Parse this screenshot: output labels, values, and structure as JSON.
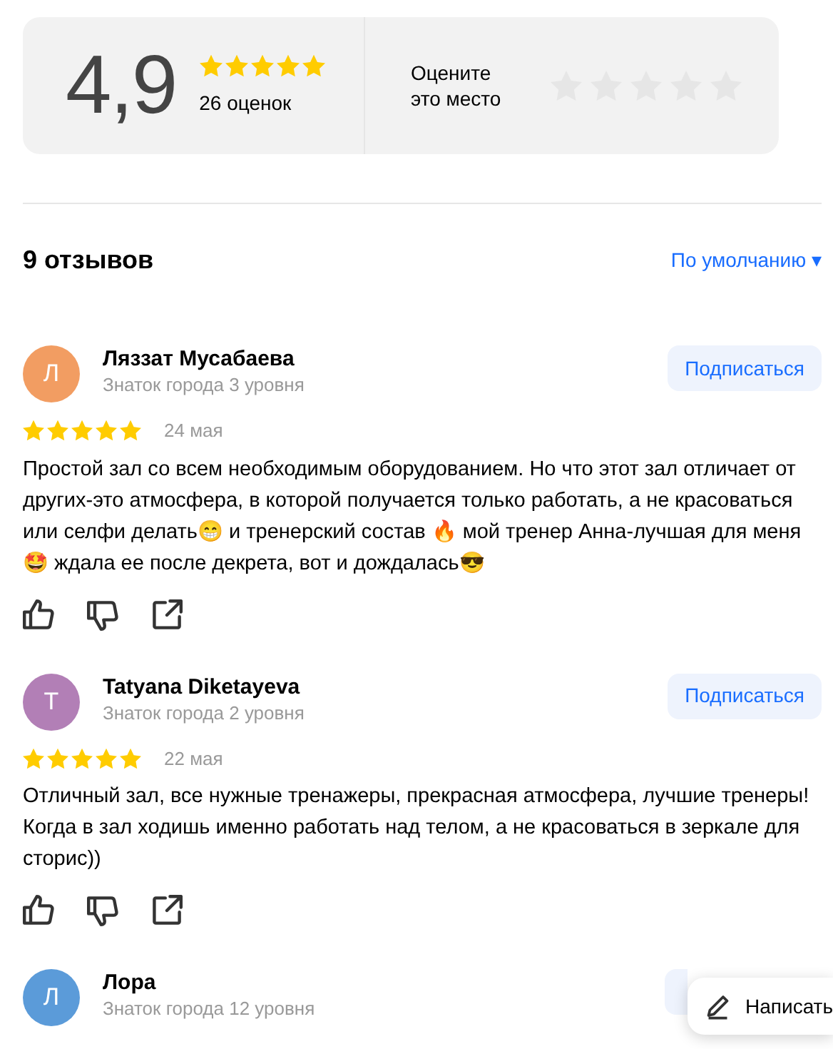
{
  "rating_summary": {
    "score": "4,9",
    "stars": 5,
    "count": "26 оценок",
    "rate": {
      "prompt": "Оцените это место"
    }
  },
  "reviews_header": {
    "title": "9 отзывов",
    "sort": "По умолчанию",
    "sort_caret": "▾"
  },
  "reviews": [
    {
      "initial": "Л",
      "color": "#f29d62",
      "name": "Ляззат Мусабаева",
      "level": "Знаток города 3 уровня",
      "subscribe": "Подписаться",
      "stars": 5,
      "date": "24 мая",
      "text": "Простой зал со всем необходимым оборудованием. Но что этот зал отличает от других-это атмосфера, в которой получается только работать, а не красоваться или селфи делать😁 и тренерский состав 🔥 мой тренер Анна-лучшая для меня🤩 ждала ее после декрета, вот и дождалась😎"
    },
    {
      "initial": "T",
      "color": "#b27fb6",
      "name": "Tatyana Diketayeva",
      "level": "Знаток города 2 уровня",
      "subscribe": "Подписаться",
      "stars": 5,
      "date": "22 мая",
      "text": "Отличный зал, все нужные тренажеры, прекрасная атмосфера, лучшие тренеры! Когда в зал ходишь именно работать над телом, а не красоваться в зеркале для сторис))"
    },
    {
      "initial": "Л",
      "color": "#5b9bd9",
      "name": "Лора",
      "level": "Знаток города 12 уровня"
    }
  ],
  "write_button": {
    "label": "Написать"
  }
}
